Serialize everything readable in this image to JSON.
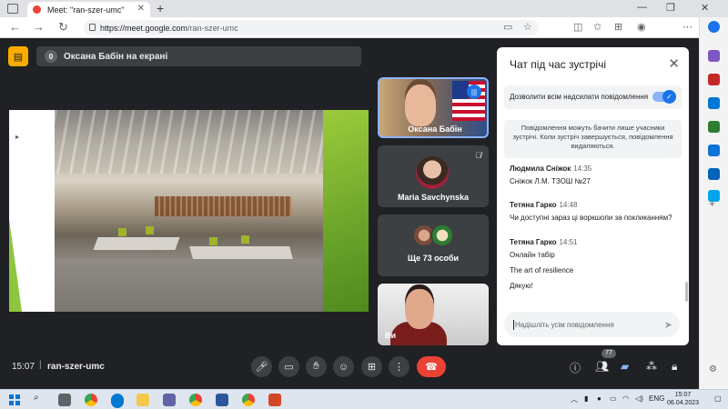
{
  "browser": {
    "tab_title": "Meet: \"ran-szer-umc\"",
    "url_host": "https://meet.google.com",
    "url_path": "/ran-szer-umc"
  },
  "meet": {
    "presenter_badge": "0",
    "presenter_text": "Оксана Бабін на екрані",
    "tiles": {
      "t1_name": "Оксана Бабін",
      "t2_name": "Maria Savchynska",
      "t3_name": "Ще 73 особи",
      "t4_name": "Ви"
    },
    "bottom": {
      "time": "15:07",
      "separator": "|",
      "meeting_code": "ran-szer-umc",
      "participants_count": "77"
    }
  },
  "chat": {
    "title": "Чат під час зустрічі",
    "toggle_label": "Дозволити всім надсилати повідомлення",
    "toggle_on": true,
    "notice": "Повідомлення можуть бачити лише учасники зустрічі. Коли зустріч завершується, повідомлення видаляються.",
    "messages": [
      {
        "sender": "Людмила Сніжок",
        "time": "14:35",
        "lines": [
          "Сніжок Л.М. ТЗОШ №27"
        ]
      },
      {
        "sender": "Тетяна Гарко",
        "time": "14:48",
        "lines": [
          "Чи доступні зараз ці воркшопи за покликанням?"
        ]
      },
      {
        "sender": "Тетяна Гарко",
        "time": "14:51",
        "lines": [
          "Онлайн табір",
          "The art of resilience",
          "Дякую!"
        ]
      }
    ],
    "input_placeholder": "Надішліть усім повідомлення"
  },
  "taskbar": {
    "lang": "ENG",
    "time": "15:07",
    "date": "06.04.2023"
  },
  "colors": {
    "meet_bg": "#202124",
    "accent_blue": "#1a73e8",
    "hangup_red": "#ea4335",
    "presenter_icon": "#f9ab00"
  }
}
